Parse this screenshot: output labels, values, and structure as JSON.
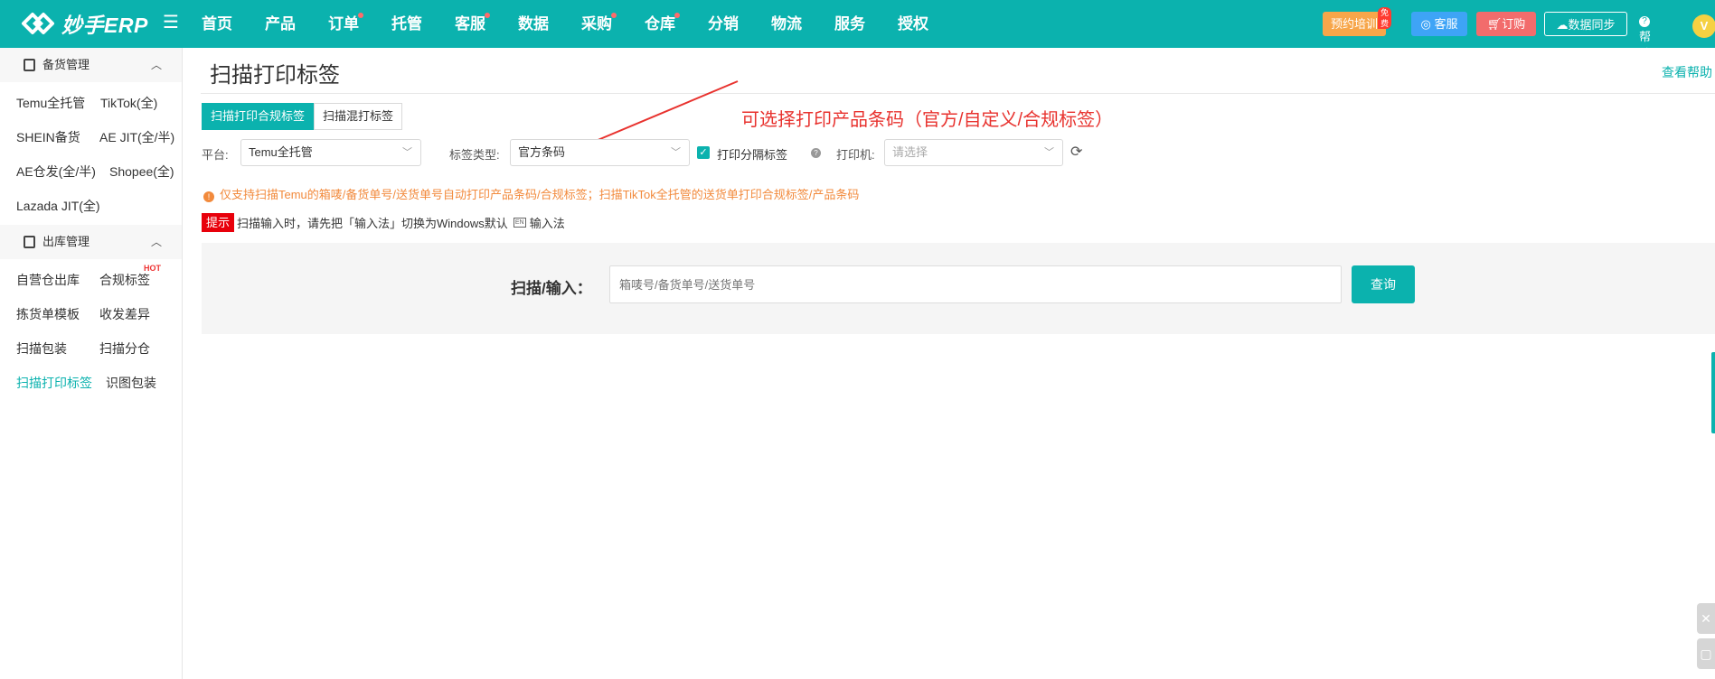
{
  "app": {
    "logo_text": "妙手ERP"
  },
  "nav": [
    {
      "label": "首页",
      "dot": false
    },
    {
      "label": "产品",
      "dot": false
    },
    {
      "label": "订单",
      "dot": true
    },
    {
      "label": "托管",
      "dot": false
    },
    {
      "label": "客服",
      "dot": true
    },
    {
      "label": "数据",
      "dot": false
    },
    {
      "label": "采购",
      "dot": true
    },
    {
      "label": "仓库",
      "dot": true
    },
    {
      "label": "分销",
      "dot": false
    },
    {
      "label": "物流",
      "dot": false
    },
    {
      "label": "服务",
      "dot": false
    },
    {
      "label": "授权",
      "dot": false
    }
  ],
  "topbar": {
    "training": "预约培训",
    "free_badge": "免费",
    "service": "客服",
    "subscribe": "订购",
    "sync": "数据同步",
    "help": "帮助"
  },
  "sidebar": {
    "group1": {
      "title": "备货管理",
      "items": [
        "Temu全托管",
        "TikTok(全)",
        "SHEIN备货",
        "AE JIT(全/半)",
        "AE仓发(全/半)",
        "Shopee(全)",
        "Lazada JIT(全)"
      ]
    },
    "group2": {
      "title": "出库管理",
      "items": [
        "自营仓出库",
        "合规标签",
        "拣货单模板",
        "收发差异",
        "扫描包装",
        "扫描分仓",
        "扫描打印标签",
        "识图包装"
      ],
      "hot_label": "HOT",
      "active": "扫描打印标签"
    }
  },
  "page": {
    "title": "扫描打印标签",
    "help_link": "查看帮助",
    "tabs": [
      "扫描打印合规标签",
      "扫描混打标签"
    ],
    "annotation": "可选择打印产品条码（官方/自定义/合规标签）",
    "filters": {
      "platform_label": "平台:",
      "platform_value": "Temu全托管",
      "label_type_label": "标签类型:",
      "label_type_value": "官方条码",
      "print_separator": "打印分隔标签",
      "printer_label": "打印机:",
      "printer_placeholder": "请选择"
    },
    "warning": "仅支持扫描Temu的箱唛/备货单号/送货单号自动打印产品条码/合规标签；扫描TikTok全托管的送货单打印合规标签/产品条码",
    "tip_badge": "提示",
    "tip_text": "扫描输入时，请先把「输入法」切换为Windows默认",
    "tip_suffix": "输入法",
    "ime_icon_text": "EN",
    "scan_label": "扫描/输入：",
    "scan_placeholder": "箱唛号/备货单号/送货单号",
    "query": "查询"
  },
  "colors": {
    "brand": "#0bb2ae",
    "annotation": "#e8322e",
    "warning": "#f28a3c",
    "tip_badge": "#e8000b"
  }
}
